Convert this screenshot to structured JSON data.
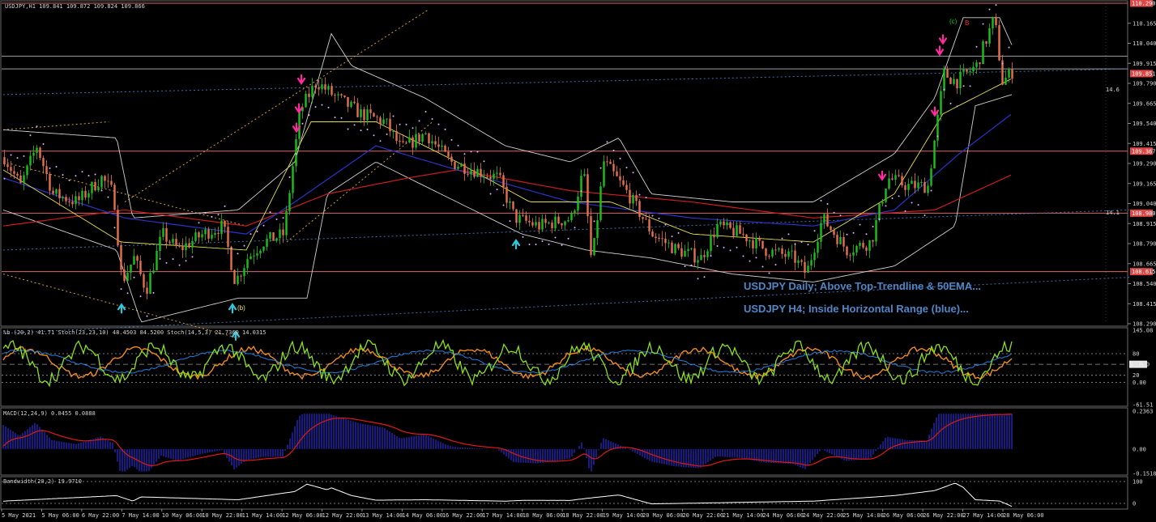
{
  "panes": {
    "main_label": "USDJPY,H1  109.841 109.872 109.824 109.866",
    "pb_label": "%b (20,2) 41.71  Stoch(23,23,10) 48.4503 84.5200  Stoch(14,5,3) 21.7360 14.0315",
    "macd_label": "MACD(12,24,9) 0.0455 0.0888",
    "bw_label": "Bandwidth(20,2) 19.9710"
  },
  "annotations": {
    "line1": "USDJPY Daily; Above Top-Trendline & 50EMA...",
    "line2": "USDJPY H4; Inside Horizontal Range (blue)...",
    "wave_b_low": "(b)",
    "wave_c": "(c)",
    "wave_B": "B",
    "side_label_1": "14.6",
    "side_label_2": "14.1"
  },
  "colors": {
    "up": "#19c219",
    "down": "#e8704a",
    "sar": "#e0b0ff",
    "bands": "#cfcfcf",
    "ema_red": "#c81e1e",
    "ema_blue": "#2a32c8",
    "ema_yellow": "#e8e04a",
    "hline": "#d86a6a",
    "blue_dotted": "#3a6fb0",
    "trend_orange": "#d4a020",
    "pb_green": "#8ae01a",
    "pb_orange": "#f08a1a",
    "pb_blue": "#2080e0",
    "macd_hist": "#2020a0",
    "macd_signal": "#e01818",
    "bw_line": "#ffffff",
    "arrow_down": "#ff2aa0",
    "arrow_up": "#30c8d8",
    "note_text": "#4f86c6"
  },
  "chart_data": {
    "type": "candlestick",
    "symbol": "USDJPY",
    "timeframe": "H1",
    "ohlc_header": {
      "open": 109.841,
      "high": 109.872,
      "low": 109.824,
      "close": 109.866
    },
    "ylim": [
      108.29,
      110.29
    ],
    "y_ticks": [
      "110.165",
      "110.040",
      "109.915",
      "109.790",
      "109.665",
      "109.540",
      "109.415",
      "109.290",
      "109.165",
      "109.040",
      "108.915",
      "108.790",
      "108.665",
      "108.540",
      "108.415",
      "108.290"
    ],
    "price_tags": [
      {
        "value": 110.29,
        "label": "110.290"
      },
      {
        "value": 109.851,
        "label": "109.851"
      },
      {
        "value": 109.367,
        "label": "109.367"
      },
      {
        "value": 108.98,
        "label": "108.980"
      },
      {
        "value": 108.615,
        "label": "108.615"
      }
    ],
    "horizontal_lines": [
      110.29,
      109.96,
      109.88,
      109.367,
      108.98,
      108.615
    ],
    "x_labels": [
      "5 May 2021",
      "5 May 06:00",
      "6 May 22:00",
      "7 May 14:00",
      "10 May 06:00",
      "10 May 22:00",
      "11 May 14:00",
      "12 May 06:00",
      "12 May 22:00",
      "13 May 14:00",
      "14 May 06:00",
      "16 May 22:00",
      "17 May 14:00",
      "18 May 06:00",
      "18 May 22:00",
      "19 May 14:00",
      "20 May 06:00",
      "20 May 22:00",
      "21 May 14:00",
      "24 May 06:00",
      "24 May 22:00",
      "25 May 14:00",
      "26 May 06:00",
      "26 May 22:00",
      "27 May 14:00",
      "28 May 06:00"
    ],
    "price_path": [
      [
        0,
        109.33
      ],
      [
        20,
        109.15
      ],
      [
        40,
        109.4
      ],
      [
        60,
        109.1
      ],
      [
        90,
        109.05
      ],
      [
        120,
        109.2
      ],
      [
        135,
        109.1
      ],
      [
        145,
        108.55
      ],
      [
        160,
        108.7
      ],
      [
        175,
        108.5
      ],
      [
        195,
        108.85
      ],
      [
        215,
        108.75
      ],
      [
        245,
        108.85
      ],
      [
        270,
        108.9
      ],
      [
        285,
        108.55
      ],
      [
        300,
        108.7
      ],
      [
        320,
        108.8
      ],
      [
        345,
        108.85
      ],
      [
        365,
        109.62
      ],
      [
        385,
        109.8
      ],
      [
        410,
        109.7
      ],
      [
        440,
        109.6
      ],
      [
        470,
        109.55
      ],
      [
        490,
        109.38
      ],
      [
        520,
        109.48
      ],
      [
        550,
        109.3
      ],
      [
        580,
        109.25
      ],
      [
        610,
        109.2
      ],
      [
        630,
        108.95
      ],
      [
        660,
        108.9
      ],
      [
        700,
        108.95
      ],
      [
        715,
        109.25
      ],
      [
        725,
        108.65
      ],
      [
        740,
        109.3
      ],
      [
        770,
        109.1
      ],
      [
        800,
        108.85
      ],
      [
        830,
        108.75
      ],
      [
        860,
        108.7
      ],
      [
        880,
        108.9
      ],
      [
        910,
        108.85
      ],
      [
        940,
        108.75
      ],
      [
        975,
        108.7
      ],
      [
        990,
        108.6
      ],
      [
        1010,
        108.95
      ],
      [
        1040,
        108.75
      ],
      [
        1070,
        108.8
      ],
      [
        1090,
        109.2
      ],
      [
        1115,
        109.15
      ],
      [
        1140,
        109.15
      ],
      [
        1160,
        109.85
      ],
      [
        1175,
        109.8
      ],
      [
        1200,
        109.9
      ],
      [
        1222,
        110.2
      ],
      [
        1232,
        109.8
      ],
      [
        1245,
        109.866
      ]
    ],
    "ema_red_path": [
      [
        0,
        108.9
      ],
      [
        150,
        109.0
      ],
      [
        300,
        108.9
      ],
      [
        400,
        109.1
      ],
      [
        500,
        109.2
      ],
      [
        560,
        109.25
      ],
      [
        700,
        109.12
      ],
      [
        850,
        109.05
      ],
      [
        1000,
        108.95
      ],
      [
        1150,
        109.0
      ],
      [
        1245,
        109.22
      ]
    ],
    "ema_blue_path": [
      [
        0,
        109.2
      ],
      [
        150,
        108.95
      ],
      [
        300,
        108.85
      ],
      [
        360,
        109.05
      ],
      [
        460,
        109.4
      ],
      [
        560,
        109.25
      ],
      [
        700,
        109.05
      ],
      [
        850,
        108.95
      ],
      [
        1000,
        108.9
      ],
      [
        1100,
        109.0
      ],
      [
        1180,
        109.35
      ],
      [
        1245,
        109.6
      ]
    ],
    "ema_yellow_path": [
      [
        0,
        109.25
      ],
      [
        145,
        108.8
      ],
      [
        300,
        108.75
      ],
      [
        380,
        109.55
      ],
      [
        460,
        109.55
      ],
      [
        560,
        109.3
      ],
      [
        650,
        109.05
      ],
      [
        750,
        109.05
      ],
      [
        850,
        108.85
      ],
      [
        1000,
        108.8
      ],
      [
        1100,
        109.1
      ],
      [
        1160,
        109.6
      ],
      [
        1245,
        109.82
      ]
    ],
    "upper_band_path": [
      [
        0,
        109.5
      ],
      [
        140,
        109.45
      ],
      [
        160,
        108.95
      ],
      [
        290,
        109.0
      ],
      [
        360,
        109.3
      ],
      [
        405,
        110.1
      ],
      [
        430,
        109.9
      ],
      [
        520,
        109.7
      ],
      [
        620,
        109.4
      ],
      [
        700,
        109.3
      ],
      [
        760,
        109.45
      ],
      [
        800,
        109.1
      ],
      [
        900,
        109.05
      ],
      [
        1000,
        109.05
      ],
      [
        1100,
        109.35
      ],
      [
        1150,
        109.7
      ],
      [
        1185,
        110.2
      ],
      [
        1230,
        110.2
      ],
      [
        1245,
        110.03
      ]
    ],
    "lower_band_path": [
      [
        0,
        109.0
      ],
      [
        140,
        108.75
      ],
      [
        170,
        108.3
      ],
      [
        290,
        108.45
      ],
      [
        375,
        108.45
      ],
      [
        400,
        109.1
      ],
      [
        460,
        109.3
      ],
      [
        540,
        109.1
      ],
      [
        640,
        108.85
      ],
      [
        720,
        108.75
      ],
      [
        800,
        108.7
      ],
      [
        900,
        108.6
      ],
      [
        1000,
        108.55
      ],
      [
        1100,
        108.65
      ],
      [
        1160,
        108.85
      ],
      [
        1175,
        108.9
      ],
      [
        1200,
        109.65
      ],
      [
        1245,
        109.72
      ]
    ],
    "trend_lines": [
      {
        "from": [
          150,
          109.05
        ],
        "to": [
          525,
          110.25
        ]
      },
      {
        "from": [
          350,
          108.8
        ],
        "to": [
          530,
          109.55
        ]
      },
      {
        "from": [
          0,
          109.5
        ],
        "to": [
          130,
          109.55
        ]
      },
      {
        "from": [
          0,
          109.3
        ],
        "to": [
          300,
          108.9
        ]
      },
      {
        "from": [
          0,
          108.6
        ],
        "to": [
          290,
          108.2
        ]
      }
    ],
    "blue_dotted_lines": [
      {
        "from": [
          0,
          109.72
        ],
        "to": [
          1390,
          109.88
        ]
      },
      {
        "from": [
          0,
          108.75
        ],
        "to": [
          1390,
          109.0
        ]
      },
      {
        "from": [
          0,
          108.23
        ],
        "to": [
          1390,
          108.58
        ]
      }
    ],
    "signals": [
      {
        "type": "sell",
        "x": 362,
        "y": 109.5
      },
      {
        "type": "sell",
        "x": 365,
        "y": 109.62
      },
      {
        "type": "sell",
        "x": 368,
        "y": 109.8
      },
      {
        "type": "buy",
        "x": 146,
        "y": 108.4
      },
      {
        "type": "buy",
        "x": 283,
        "y": 108.4
      },
      {
        "type": "buy",
        "x": 287,
        "y": 108.23
      },
      {
        "type": "buy",
        "x": 633,
        "y": 108.8
      },
      {
        "type": "sell",
        "x": 1085,
        "y": 109.2
      },
      {
        "type": "sell",
        "x": 1150,
        "y": 109.6
      },
      {
        "type": "sell",
        "x": 1156,
        "y": 109.98
      },
      {
        "type": "sell",
        "x": 1160,
        "y": 110.05
      }
    ],
    "pb_pane": {
      "ylim": [
        -61.51,
        145.08
      ],
      "ticks": [
        "145.08",
        "80",
        "50.50",
        "20",
        "0.00",
        "-61.51"
      ]
    },
    "macd_pane": {
      "ylim": [
        -0.1518,
        0.2363
      ],
      "ticks": [
        "0.2363",
        "0.00",
        "-0.1518"
      ]
    },
    "bw_pane": {
      "ticks": [
        "100",
        "0"
      ]
    }
  }
}
